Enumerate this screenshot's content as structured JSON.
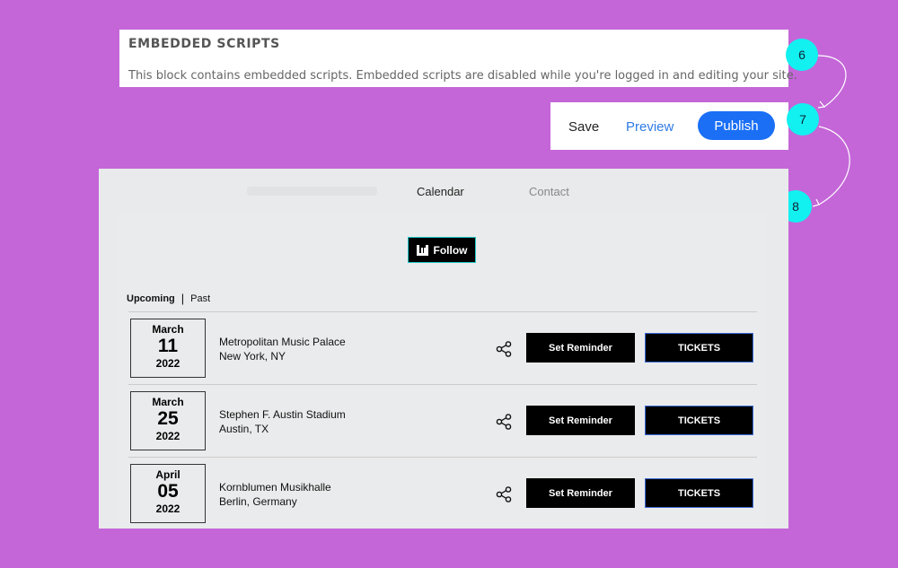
{
  "notice": {
    "title": "EMBEDDED SCRIPTS",
    "text": "This block contains embedded scripts. Embedded scripts are disabled while you're logged in and editing your site."
  },
  "editor": {
    "save_label": "Save",
    "preview_label": "Preview",
    "publish_label": "Publish"
  },
  "steps": [
    "6",
    "7",
    "8"
  ],
  "site": {
    "nav": {
      "calendar": "Calendar",
      "contact": "Contact"
    },
    "follow_label": "Follow",
    "tabs": {
      "upcoming": "Upcoming",
      "separator": "|",
      "past": "Past"
    },
    "events": [
      {
        "month": "March",
        "day": "11",
        "year": "2022",
        "venue": "Metropolitan Music Palace",
        "location": "New York, NY",
        "reminder_label": "Set Reminder",
        "tickets_label": "TICKETS"
      },
      {
        "month": "March",
        "day": "25",
        "year": "2022",
        "venue": "Stephen F. Austin Stadium",
        "location": "Austin, TX",
        "reminder_label": "Set Reminder",
        "tickets_label": "TICKETS"
      },
      {
        "month": "April",
        "day": "05",
        "year": "2022",
        "venue": "Kornblumen Musikhalle",
        "location": "Berlin, Germany",
        "reminder_label": "Set Reminder",
        "tickets_label": "TICKETS"
      }
    ]
  },
  "colors": {
    "background": "#c466d8",
    "step_badge": "#12f0f0",
    "publish": "#1a6ff5",
    "preview_link": "#2f7be5"
  },
  "icons": {
    "follow": "bandsintown-icon",
    "share": "share-icon"
  }
}
